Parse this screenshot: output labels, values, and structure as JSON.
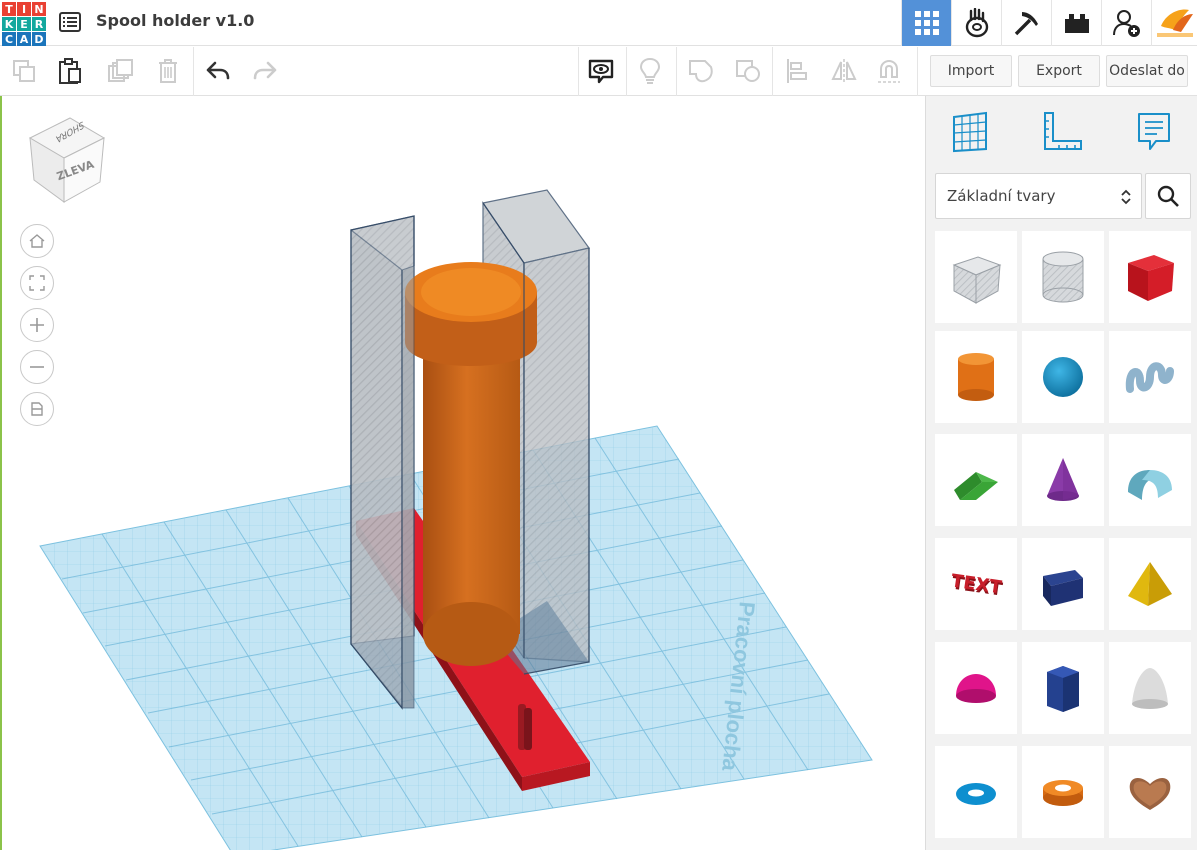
{
  "app": {
    "logo_letters": [
      "T",
      "I",
      "N",
      "K",
      "E",
      "R",
      "C",
      "A",
      "D"
    ],
    "title": "Spool holder v1.0"
  },
  "topbar": {
    "buttons": [
      {
        "name": "design-3d-icon",
        "active": true
      },
      {
        "name": "circuits-hand-icon",
        "active": false
      },
      {
        "name": "minecraft-pickaxe-icon",
        "active": false
      },
      {
        "name": "bricks-icon",
        "active": false
      },
      {
        "name": "add-user-icon",
        "active": false
      },
      {
        "name": "voxelizer-brand-icon",
        "active": false
      }
    ]
  },
  "toolbar": {
    "import_label": "Import",
    "export_label": "Export",
    "send_label": "Odeslat do"
  },
  "viewcube": {
    "front_label": "ZLEVA",
    "top_label": "SHORA"
  },
  "workplane": {
    "watermark": "Pracovní plocha"
  },
  "panel": {
    "category": "Základní tvary",
    "shapes": [
      {
        "name": "box-hole"
      },
      {
        "name": "cylinder-hole"
      },
      {
        "name": "box"
      },
      {
        "name": "cylinder"
      },
      {
        "name": "sphere"
      },
      {
        "name": "scribble"
      },
      {
        "name": "roof"
      },
      {
        "name": "cone"
      },
      {
        "name": "round-roof"
      },
      {
        "name": "text",
        "label": "TEXT"
      },
      {
        "name": "wedge"
      },
      {
        "name": "pyramid"
      },
      {
        "name": "half-sphere"
      },
      {
        "name": "polygon"
      },
      {
        "name": "paraboloid"
      },
      {
        "name": "torus"
      },
      {
        "name": "tube"
      },
      {
        "name": "heart"
      }
    ]
  },
  "colors": {
    "accent_blue": "#5391d8",
    "box_red": "#d9202c",
    "cylinder_orange": "#e87c1c"
  }
}
